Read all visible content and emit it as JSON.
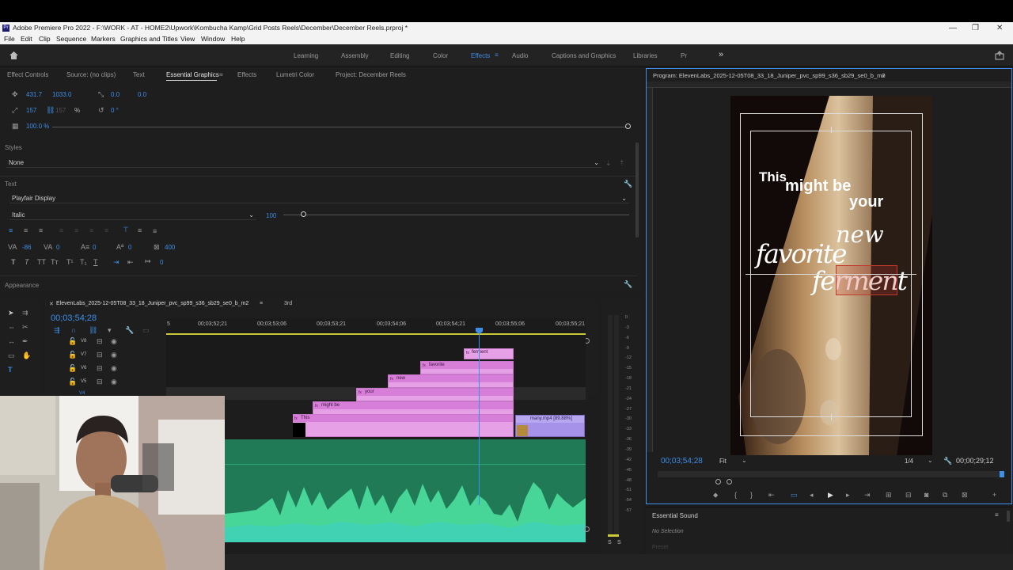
{
  "window": {
    "title": "Adobe Premiere Pro 2022 - F:\\WORK - AT - HOME2\\Upwork\\Kombucha Kamp\\Grid Posts Reels\\December\\December Reels.prproj *",
    "app_badge": "Pr",
    "controls": {
      "minimize": "—",
      "maximize": "❐",
      "close": "✕"
    }
  },
  "menu": [
    "File",
    "Edit",
    "Clip",
    "Sequence",
    "Markers",
    "Graphics and Titles",
    "View",
    "Window",
    "Help"
  ],
  "workspaces": {
    "items": [
      "Learning",
      "Assembly",
      "Editing",
      "Color",
      "Effects",
      "Audio",
      "Captions and Graphics",
      "Libraries",
      "Pr"
    ],
    "active": "Effects",
    "more": "»"
  },
  "left_panel": {
    "tabs": [
      "Effect Controls",
      "Source: (no clips)",
      "Text",
      "Essential Graphics",
      "Effects",
      "Lumetri Color",
      "Project: December Reels"
    ],
    "active_tab": "Essential Graphics",
    "transform": {
      "pos_x": "431.7",
      "pos_y": "1033.0",
      "anchor_x": "0.0",
      "anchor_y": "0.0",
      "scale": "157",
      "scale_link": "157",
      "percent": "%",
      "rotation": "0 °",
      "opacity": "100.0 %"
    },
    "styles": {
      "label": "Styles",
      "value": "None"
    },
    "text": {
      "label": "Text",
      "font": "Playfair Display",
      "style": "Italic",
      "size": "100",
      "tracking": "-86",
      "kerning": "0",
      "leading": "0",
      "baseline": "0",
      "tsume": "400"
    },
    "type_buttons": [
      "T",
      "T",
      "TT",
      "Tт",
      "T¹",
      "T₁",
      "T"
    ],
    "appearance": {
      "label": "Appearance"
    }
  },
  "timeline": {
    "tabs": [
      "ElevenLabs_2025-12-05T08_33_18_Juniper_pvc_sp99_s36_sb29_se0_b_m2",
      "3rd"
    ],
    "timecode": "00;03;54;28",
    "ruler": [
      "5",
      "00;03;52;21",
      "00;03;53;06",
      "00;03;53;21",
      "00;03;54;06",
      "00;03;54;21",
      "00;03;55;06",
      "00;03;55;21"
    ],
    "tracks": [
      "V8",
      "V7",
      "V6",
      "V5",
      "V4"
    ],
    "clips": [
      {
        "label": "ferment"
      },
      {
        "label": "favorite"
      },
      {
        "label": "new"
      },
      {
        "label": "your"
      },
      {
        "label": "might be"
      },
      {
        "label": "This"
      }
    ],
    "video_clip": "many.mp4 [89.88%]",
    "meter_ticks": [
      "0",
      "-3",
      "-6",
      "-9",
      "-12",
      "-15",
      "-18",
      "-21",
      "-24",
      "-27",
      "-30",
      "-33",
      "-36",
      "-39",
      "-42",
      "-45",
      "-48",
      "-51",
      "-54",
      "-57"
    ],
    "meter_solo": [
      "S",
      "S"
    ]
  },
  "program": {
    "title": "Program: ElevenLabs_2025-12-05T08_33_18_Juniper_pvc_sp99_s36_sb29_se0_b_m2",
    "caption_lines": [
      "This",
      "might be",
      "your",
      "new",
      "favorite",
      "ferment"
    ],
    "timecode": "00;03;54;28",
    "fit": "Fit",
    "resolution": "1/4",
    "duration": "00;00;29;12"
  },
  "essential_sound": {
    "title": "Essential Sound",
    "status": "No Selection",
    "preset": "Preset"
  },
  "colors": {
    "accent": "#3d8ee8",
    "graphic_clip": "#e5a0e6",
    "audio_track": "#1f7a55",
    "video_clip": "#a692e8"
  }
}
